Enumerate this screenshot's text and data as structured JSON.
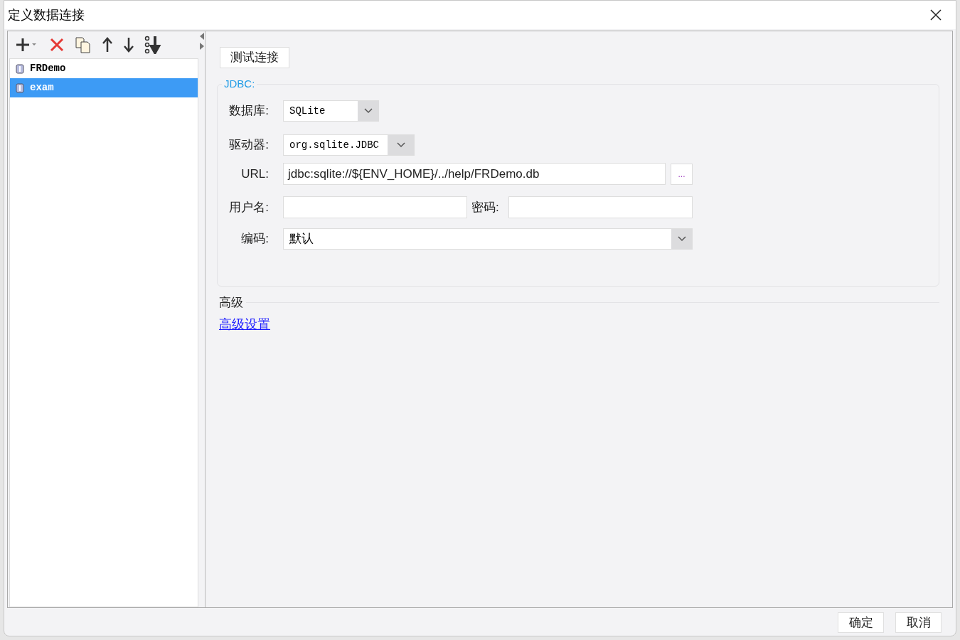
{
  "window": {
    "title": "定义数据连接"
  },
  "connections": [
    {
      "name": "FRDemo",
      "selected": false
    },
    {
      "name": "exam",
      "selected": true
    }
  ],
  "test_button": "测试连接",
  "jdbc": {
    "legend": "JDBC:",
    "database": {
      "label": "数据库:",
      "value": "SQLite"
    },
    "driver": {
      "label": "驱动器:",
      "value": "org.sqlite.JDBC"
    },
    "url": {
      "label": "URL:",
      "value": "jdbc:sqlite://${ENV_HOME}/../help/FRDemo.db",
      "browse": "..."
    },
    "username": {
      "label": "用户名:"
    },
    "password": {
      "label": "密码:"
    },
    "encoding": {
      "label": "编码:",
      "value": "默认"
    }
  },
  "advanced": {
    "title": "高级",
    "link": "高级设置"
  },
  "buttons": [
    "确定",
    "取消"
  ]
}
